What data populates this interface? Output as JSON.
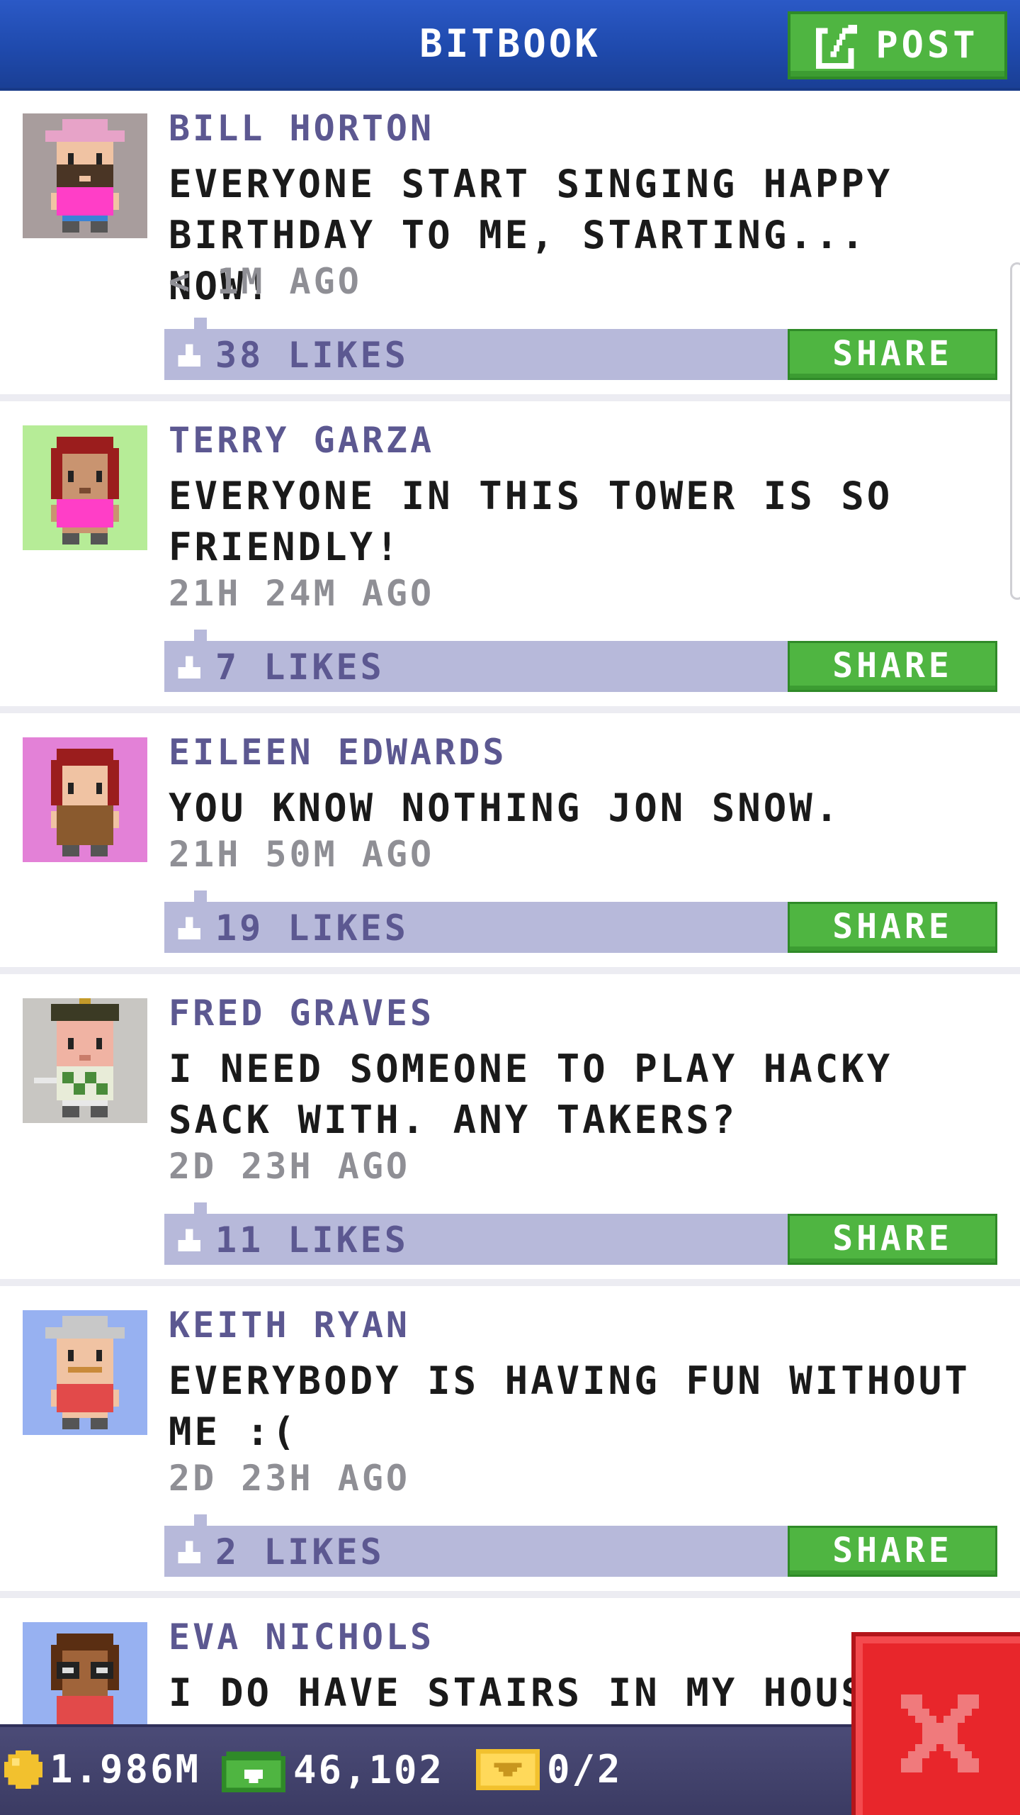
{
  "app": {
    "title": "BITBOOK",
    "post_label": "POST"
  },
  "posts": [
    {
      "author": "BILL HORTON",
      "message": "EVERYONE START SINGING HAPPY BIRTHDAY TO ME, STARTING... NOW!",
      "time": "< 1M AGO",
      "likes": "38 LIKES",
      "share_label": "SHARE",
      "avatar_icon": "avatar-pink-cap-bearded-man-icon",
      "avatar_bg": "#a89d9d"
    },
    {
      "author": "TERRY GARZA",
      "message": "EVERYONE IN THIS TOWER IS SO FRIENDLY!",
      "time": "21H 24M AGO",
      "likes": "7 LIKES",
      "share_label": "SHARE",
      "avatar_icon": "avatar-red-hair-woman-icon",
      "avatar_bg": "#b6ec97"
    },
    {
      "author": "EILEEN EDWARDS",
      "message": "YOU KNOW NOTHING JON SNOW.",
      "time": "21H 50M AGO",
      "likes": "19 LIKES",
      "share_label": "SHARE",
      "avatar_icon": "avatar-red-hair-woman-brown-dress-icon",
      "avatar_bg": "#e381d7"
    },
    {
      "author": "FRED GRAVES",
      "message": "I NEED SOMEONE TO PLAY HACKY SACK WITH. ANY TAKERS?",
      "time": "2D 23H AGO",
      "likes": "11 LIKES",
      "share_label": "SHARE",
      "avatar_icon": "avatar-golfer-man-icon",
      "avatar_bg": "#c8c6c2"
    },
    {
      "author": "KEITH RYAN",
      "message": "EVERYBODY IS HAVING FUN WITHOUT ME :(",
      "time": "2D 23H AGO",
      "likes": "2 LIKES",
      "share_label": "SHARE",
      "avatar_icon": "avatar-grey-cap-mustache-man-icon",
      "avatar_bg": "#97b1f1"
    },
    {
      "author": "EVA NICHOLS",
      "message": "I DO HAVE STAIRS IN MY HOUSE",
      "avatar_icon": "avatar-glasses-woman-icon",
      "avatar_bg": "#97b1f1"
    }
  ],
  "status": {
    "coins": "1.986M",
    "bux": "46,102",
    "tickets": "0/2"
  },
  "colors": {
    "header_blue": "#1f4aad",
    "share_green": "#4fb541",
    "likes_bar": "#b7b9da",
    "author_purple": "#5c5891",
    "close_red": "#e8262b"
  }
}
